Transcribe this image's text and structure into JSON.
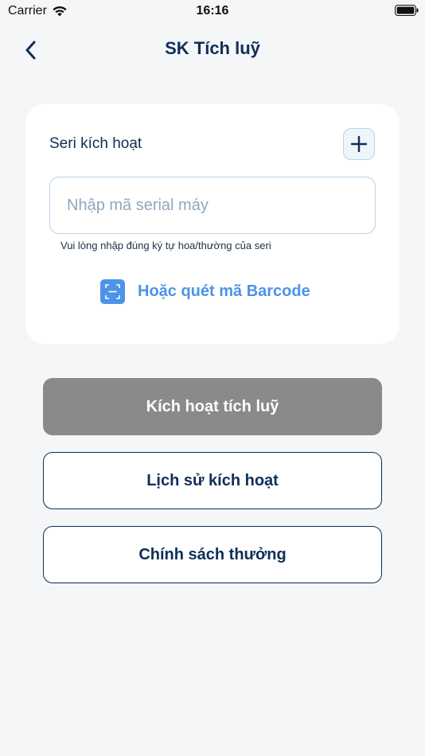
{
  "status_bar": {
    "carrier": "Carrier",
    "time": "16:16",
    "wifi_icon": "wifi-icon",
    "battery_icon": "battery-icon"
  },
  "nav": {
    "back_icon": "chevron-left-icon",
    "title": "SK Tích luỹ"
  },
  "card": {
    "serial_label": "Seri kích hoạt",
    "add_icon": "plus-icon",
    "serial_input": {
      "value": "",
      "placeholder": "Nhập mã serial máy"
    },
    "hint": "Vui lòng nhập đúng ký tự hoa/thường của seri",
    "barcode_icon": "barcode-scan-icon",
    "barcode_label": "Hoặc quét mã Barcode"
  },
  "buttons": {
    "activate": "Kích hoạt tích luỹ",
    "history": "Lịch sử kích hoạt",
    "policy": "Chính sách thưởng"
  },
  "colors": {
    "primary_text": "#0f2e57",
    "accent_blue": "#4d93e8",
    "disabled_button": "#8a8a8a",
    "background": "#f4f6f8",
    "card": "#ffffff",
    "input_border": "#b9d3ea"
  }
}
